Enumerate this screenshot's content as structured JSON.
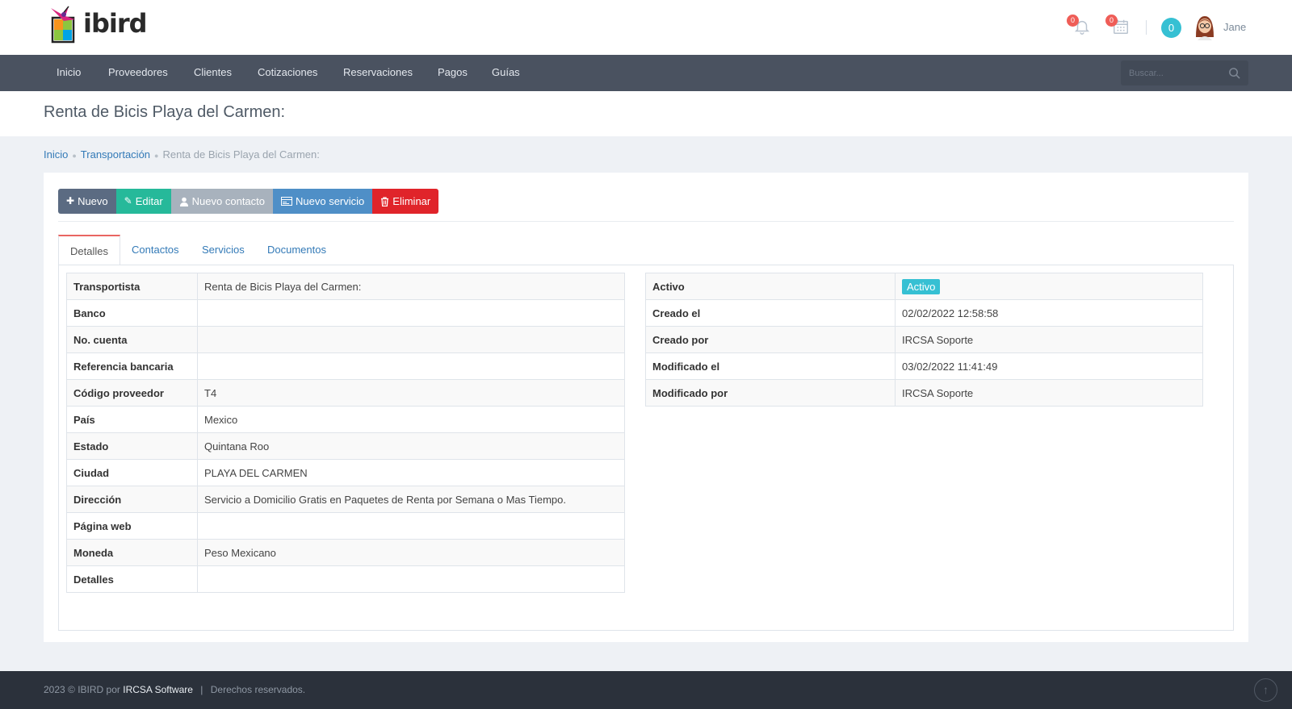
{
  "brand": {
    "logo_text": "ibird"
  },
  "header": {
    "notifications_count": "0",
    "calendar_count": "0",
    "cart_count": "0",
    "username": "Jane"
  },
  "nav": {
    "items": [
      "Inicio",
      "Proveedores",
      "Clientes",
      "Cotizaciones",
      "Reservaciones",
      "Pagos",
      "Guías"
    ],
    "search_placeholder": "Buscar..."
  },
  "page": {
    "title": "Renta de Bicis Playa del Carmen:"
  },
  "breadcrumb": {
    "items": [
      "Inicio",
      "Transportación",
      "Renta de Bicis Playa del Carmen:"
    ]
  },
  "actions": {
    "new": "Nuevo",
    "edit": "Editar",
    "new_contact": "Nuevo contacto",
    "new_service": "Nuevo servicio",
    "delete": "Eliminar"
  },
  "tabs": [
    "Detalles",
    "Contactos",
    "Servicios",
    "Documentos"
  ],
  "details": {
    "rows": [
      {
        "label": "Transportista",
        "value": "Renta de Bicis Playa del Carmen:"
      },
      {
        "label": "Banco",
        "value": ""
      },
      {
        "label": "No. cuenta",
        "value": ""
      },
      {
        "label": "Referencia bancaria",
        "value": ""
      },
      {
        "label": "Código proveedor",
        "value": "T4"
      },
      {
        "label": "País",
        "value": "Mexico"
      },
      {
        "label": "Estado",
        "value": "Quintana Roo"
      },
      {
        "label": "Ciudad",
        "value": "PLAYA DEL CARMEN"
      },
      {
        "label": "Dirección",
        "value": "Servicio a Domicilio Gratis en Paquetes de Renta por Semana o Mas Tiempo."
      },
      {
        "label": "Página web",
        "value": ""
      },
      {
        "label": "Moneda",
        "value": "Peso Mexicano"
      },
      {
        "label": "Detalles",
        "value": ""
      }
    ]
  },
  "meta": {
    "rows": [
      {
        "label": "Activo",
        "value": "Activo",
        "badge": true
      },
      {
        "label": "Creado el",
        "value": "02/02/2022 12:58:58"
      },
      {
        "label": "Creado por",
        "value": "IRCSA Soporte"
      },
      {
        "label": "Modificado el",
        "value": "03/02/2022 11:41:49"
      },
      {
        "label": "Modificado por",
        "value": "IRCSA Soporte"
      }
    ]
  },
  "footer": {
    "prefix": "2023 © IBIRD por",
    "company": "IRCSA Software",
    "separator": "|",
    "rights": "Derechos reservados."
  },
  "colors": {
    "nav_bg": "#4a5260",
    "accent_teal": "#26b99a",
    "accent_cyan": "#36c0d3",
    "danger": "#e0242a",
    "badge_red": "#ef5d57"
  }
}
